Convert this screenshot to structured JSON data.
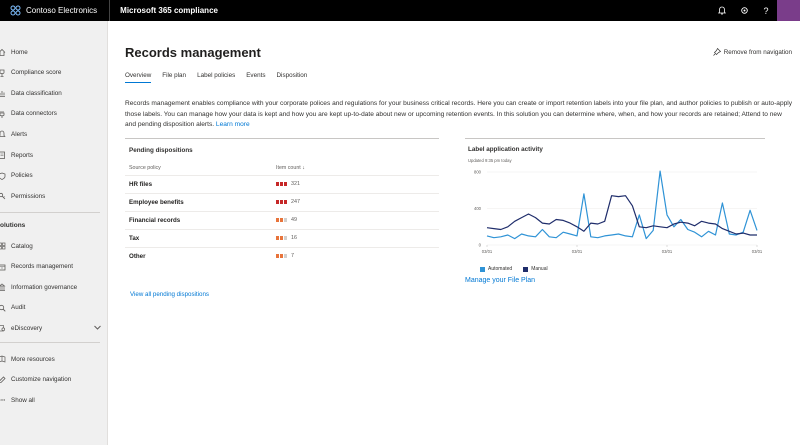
{
  "topbar": {
    "brand_name": "Contoso Electronics",
    "app_name": "Microsoft 365 compliance",
    "icons": [
      "bell-icon",
      "gear-icon",
      "help-icon",
      "avatar"
    ],
    "help_glyph": "?"
  },
  "sidebar": {
    "items": [
      {
        "label": "Home",
        "icon": "home-icon"
      },
      {
        "label": "Compliance score",
        "icon": "trophy-icon"
      },
      {
        "label": "Data classification",
        "icon": "chart-icon"
      },
      {
        "label": "Data connectors",
        "icon": "plug-icon"
      },
      {
        "label": "Alerts",
        "icon": "bell-icon"
      },
      {
        "label": "Reports",
        "icon": "report-icon"
      },
      {
        "label": "Policies",
        "icon": "policy-icon"
      },
      {
        "label": "Permissions",
        "icon": "key-icon"
      }
    ],
    "section_label": "olutions",
    "solutions": [
      {
        "label": "Catalog",
        "icon": "catalog-icon"
      },
      {
        "label": "Records management",
        "icon": "records-icon"
      },
      {
        "label": "Information governance",
        "icon": "governance-icon"
      },
      {
        "label": "Audit",
        "icon": "audit-icon"
      },
      {
        "label": "eDiscovery",
        "icon": "ediscovery-icon"
      }
    ],
    "bottom": [
      {
        "label": "More resources",
        "icon": "resources-icon"
      },
      {
        "label": "Customize navigation",
        "icon": "edit-icon"
      },
      {
        "label": "Show all",
        "icon": "ellipsis-icon"
      }
    ]
  },
  "main": {
    "title": "Records management",
    "remove_navigation": "Remove from navigation",
    "tabs": [
      {
        "label": "Overview",
        "active": true
      },
      {
        "label": "File plan"
      },
      {
        "label": "Label policies"
      },
      {
        "label": "Events"
      },
      {
        "label": "Disposition"
      }
    ],
    "description": "Records management enables compliance with your corporate polices and regulations for your business critical records. Here you can create or import retention labels into your file plan, and author policies to publish or auto-apply those labels. You can manage how your data is kept and how you are kept up-to-date about new or upcoming retention events. In this solution you can determine where, when, and how your records are retained; Attend to new and pending disposition alerts.",
    "learn_more": "Learn more"
  },
  "pending": {
    "title": "Pending dispositions",
    "col_policy": "Source policy",
    "col_count": "Item count  ↓",
    "rows": [
      {
        "name": "HR files",
        "count": "321",
        "level": 3
      },
      {
        "name": "Employee benefits",
        "count": "247",
        "level": 3
      },
      {
        "name": "Financial records",
        "count": "49",
        "level": 2
      },
      {
        "name": "Tax",
        "count": "16",
        "level": 2
      },
      {
        "name": "Other",
        "count": "7",
        "level": 2
      }
    ],
    "view_all": "View all pending dispositions"
  },
  "activity": {
    "title": "Label application activity",
    "updated": "Updated 9:35 pm today",
    "manage_link": "Manage your File Plan"
  },
  "colors": {
    "accent": "#0078d4",
    "automated": "#2f93d6",
    "manual": "#1f2d6b",
    "severity_high": "#c62828",
    "severity_med": "#e8743b",
    "severity_empty": "#d2d0ce"
  },
  "chart_data": {
    "type": "line",
    "title": "Label application activity",
    "ylim": [
      0,
      800
    ],
    "yticks": [
      "800",
      "400",
      "0"
    ],
    "xticks": [
      "03/01",
      "03/01",
      "03/01",
      "03/01"
    ],
    "x": [
      0,
      1,
      2,
      3,
      4,
      5,
      6,
      7,
      8,
      9,
      10,
      11,
      12,
      13,
      14,
      15,
      16,
      17,
      18,
      19,
      20,
      21,
      22,
      23,
      24,
      25,
      26,
      27,
      28,
      29,
      30,
      31,
      32,
      33,
      34,
      35,
      36,
      37,
      38,
      39
    ],
    "series": [
      {
        "name": "Automated",
        "values": [
          100,
          80,
          90,
          110,
          70,
          120,
          100,
          90,
          170,
          90,
          80,
          140,
          120,
          100,
          560,
          90,
          80,
          100,
          110,
          120,
          100,
          90,
          330,
          70,
          160,
          810,
          330,
          200,
          280,
          170,
          140,
          90,
          150,
          110,
          460,
          120,
          110,
          140,
          380,
          160
        ]
      },
      {
        "name": "Manual",
        "values": [
          190,
          180,
          170,
          200,
          260,
          300,
          340,
          300,
          240,
          230,
          280,
          270,
          240,
          200,
          150,
          240,
          230,
          260,
          540,
          530,
          540,
          430,
          200,
          190,
          210,
          200,
          190,
          230,
          250,
          240,
          210,
          260,
          240,
          230,
          180,
          150,
          120,
          130,
          110,
          110
        ]
      }
    ],
    "legend": [
      "Automated",
      "Manual"
    ],
    "legend_position": "bottom-left"
  }
}
